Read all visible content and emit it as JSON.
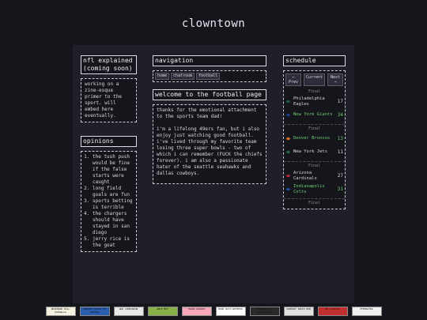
{
  "site": {
    "title": "clowntown"
  },
  "left": {
    "nfl_heading": "nfl explained (coming soon)",
    "nfl_text": "working on a zine-esque primer to the sport. will embed here eventually.",
    "opinions_heading": "opinions",
    "opinions": [
      "the tush push would be fine if the false starts were caught",
      "long field goals are fun",
      "sports betting is terrible",
      "the chargers should have stayed in san diego",
      "jerry rice is the goat"
    ]
  },
  "center": {
    "nav_heading": "navigation",
    "nav_links": [
      "home",
      "chatroom",
      "football"
    ],
    "welcome_heading": "welcome to the football page",
    "welcome_paragraphs": [
      "thanks for the emotional attachment to the sports team dad!",
      "i'm a lifelong 49ers fan, but i also enjoy just watching good football. i've lived through my favorite team losing three super bowls - two of which i can remember (FUCK the chiefs forever). i am also a passionate hater of the seattle seahawks and dallas cowboys."
    ]
  },
  "schedule": {
    "heading": "schedule",
    "prev_label": "← Prev",
    "current_label": "Current",
    "next_label": "Next →",
    "games": [
      {
        "status": "Final",
        "teams": [
          {
            "name": "Philadelphia Eagles",
            "score": "17",
            "winner": false,
            "color": "#1d5c52",
            "icon": "eagles-logo-icon"
          },
          {
            "name": "New York Giants",
            "score": "34",
            "winner": true,
            "color": "#1e3f8c",
            "icon": "giants-logo-icon"
          }
        ]
      },
      {
        "status": "Final",
        "teams": [
          {
            "name": "Denver Broncos",
            "score": "13",
            "winner": true,
            "color": "#e0702a",
            "icon": "broncos-logo-icon"
          },
          {
            "name": "New York Jets",
            "score": "11",
            "winner": false,
            "color": "#1e6b3f",
            "icon": "jets-logo-icon"
          }
        ]
      },
      {
        "status": "Final",
        "teams": [
          {
            "name": "Arizona Cardinals",
            "score": "27",
            "winner": false,
            "color": "#b3253a",
            "icon": "cardinals-logo-icon"
          },
          {
            "name": "Indianapolis Colts",
            "score": "31",
            "winner": true,
            "color": "#1d4e9e",
            "icon": "colts-logo-icon"
          }
        ]
      },
      {
        "status": "Final",
        "teams": []
      }
    ]
  },
  "badges": [
    {
      "label": "BOOKMARK KILL PAYWALLS",
      "bg": "#f4f0e0"
    },
    {
      "label": "SUPPORT RIGHT TO REPAIR",
      "bg": "#2a5fb0"
    },
    {
      "label": "GNU COMPANION",
      "bg": "#e8e8e8"
    },
    {
      "label": "ANTI NFT",
      "bg": "#8ab04a"
    },
    {
      "label": "TRANS RIGHTS",
      "bg": "#f7a8b8"
    },
    {
      "label": "MADE WITH NOTEPAD",
      "bg": "#ffffff"
    },
    {
      "label": "INDEXED BY MARGINALIA",
      "bg": "#2a2a2a"
    },
    {
      "label": "SUPPORT INDIE WEB",
      "bg": "#e0e0e0"
    },
    {
      "label": "No Cookies",
      "bg": "#c03030"
    },
    {
      "label": "FEDERATED",
      "bg": "#f0f0f0"
    }
  ]
}
